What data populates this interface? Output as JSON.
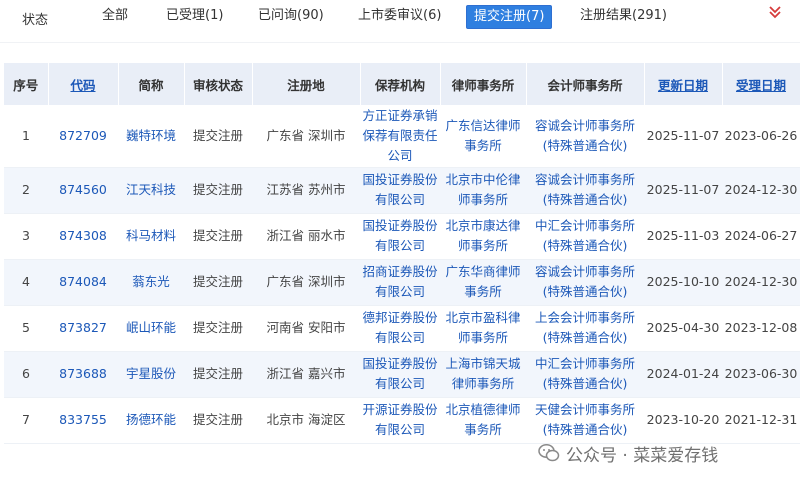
{
  "filter": {
    "label": "状态",
    "tabs": [
      "全部",
      "已受理(1)",
      "已问询(90)",
      "上市委审议(6)",
      "提交注册(7)",
      "注册结果(291)"
    ],
    "active_index": 4
  },
  "table": {
    "headers": [
      "序号",
      "代码",
      "简称",
      "审核状态",
      "注册地",
      "保荐机构",
      "律师事务所",
      "会计师事务所",
      "更新日期",
      "受理日期"
    ],
    "rows": [
      {
        "no": "1",
        "code": "872709",
        "name": "巍特环境",
        "status": "提交注册",
        "place": "广东省 深圳市",
        "sponsor": "方正证券承销保荐有限责任公司",
        "lawfirm": "广东信达律师事务所",
        "accounting": "容诚会计师事务所(特殊普通合伙)",
        "updated": "2025-11-07",
        "accepted": "2023-06-26"
      },
      {
        "no": "2",
        "code": "874560",
        "name": "江天科技",
        "status": "提交注册",
        "place": "江苏省 苏州市",
        "sponsor": "国投证券股份有限公司",
        "lawfirm": "北京市中伦律师事务所",
        "accounting": "容诚会计师事务所(特殊普通合伙)",
        "updated": "2025-11-07",
        "accepted": "2024-12-30"
      },
      {
        "no": "3",
        "code": "874308",
        "name": "科马材料",
        "status": "提交注册",
        "place": "浙江省 丽水市",
        "sponsor": "国投证券股份有限公司",
        "lawfirm": "北京市康达律师事务所",
        "accounting": "中汇会计师事务所(特殊普通合伙)",
        "updated": "2025-11-03",
        "accepted": "2024-06-27"
      },
      {
        "no": "4",
        "code": "874084",
        "name": "蓊东光",
        "status": "提交注册",
        "place": "广东省 深圳市",
        "sponsor": "招商证券股份有限公司",
        "lawfirm": "广东华商律师事务所",
        "accounting": "容诚会计师事务所(特殊普通合伙)",
        "updated": "2025-10-10",
        "accepted": "2024-12-30"
      },
      {
        "no": "5",
        "code": "873827",
        "name": "岷山环能",
        "status": "提交注册",
        "place": "河南省 安阳市",
        "sponsor": "德邦证券股份有限公司",
        "lawfirm": "北京市盈科律师事务所",
        "accounting": "上会会计师事务所(特殊普通合伙)",
        "updated": "2025-04-30",
        "accepted": "2023-12-08"
      },
      {
        "no": "6",
        "code": "873688",
        "name": "宇星股份",
        "status": "提交注册",
        "place": "浙江省 嘉兴市",
        "sponsor": "国投证券股份有限公司",
        "lawfirm": "上海市锦天城律师事务所",
        "accounting": "中汇会计师事务所(特殊普通合伙)",
        "updated": "2024-01-24",
        "accepted": "2023-06-30"
      },
      {
        "no": "7",
        "code": "833755",
        "name": "扬德环能",
        "status": "提交注册",
        "place": "北京市 海淀区",
        "sponsor": "开源证券股份有限公司",
        "lawfirm": "北京植德律师事务所",
        "accounting": "天健会计师事务所(特殊普通合伙)",
        "updated": "2023-10-20",
        "accepted": "2021-12-31"
      }
    ]
  },
  "watermark": {
    "text": "公众号 · 菜菜爱存钱"
  },
  "colors": {
    "accent": "#2f7fe0",
    "link": "#1c58b8",
    "header_bg": "#e9eef7",
    "row_alt": "#f2f6fc"
  }
}
